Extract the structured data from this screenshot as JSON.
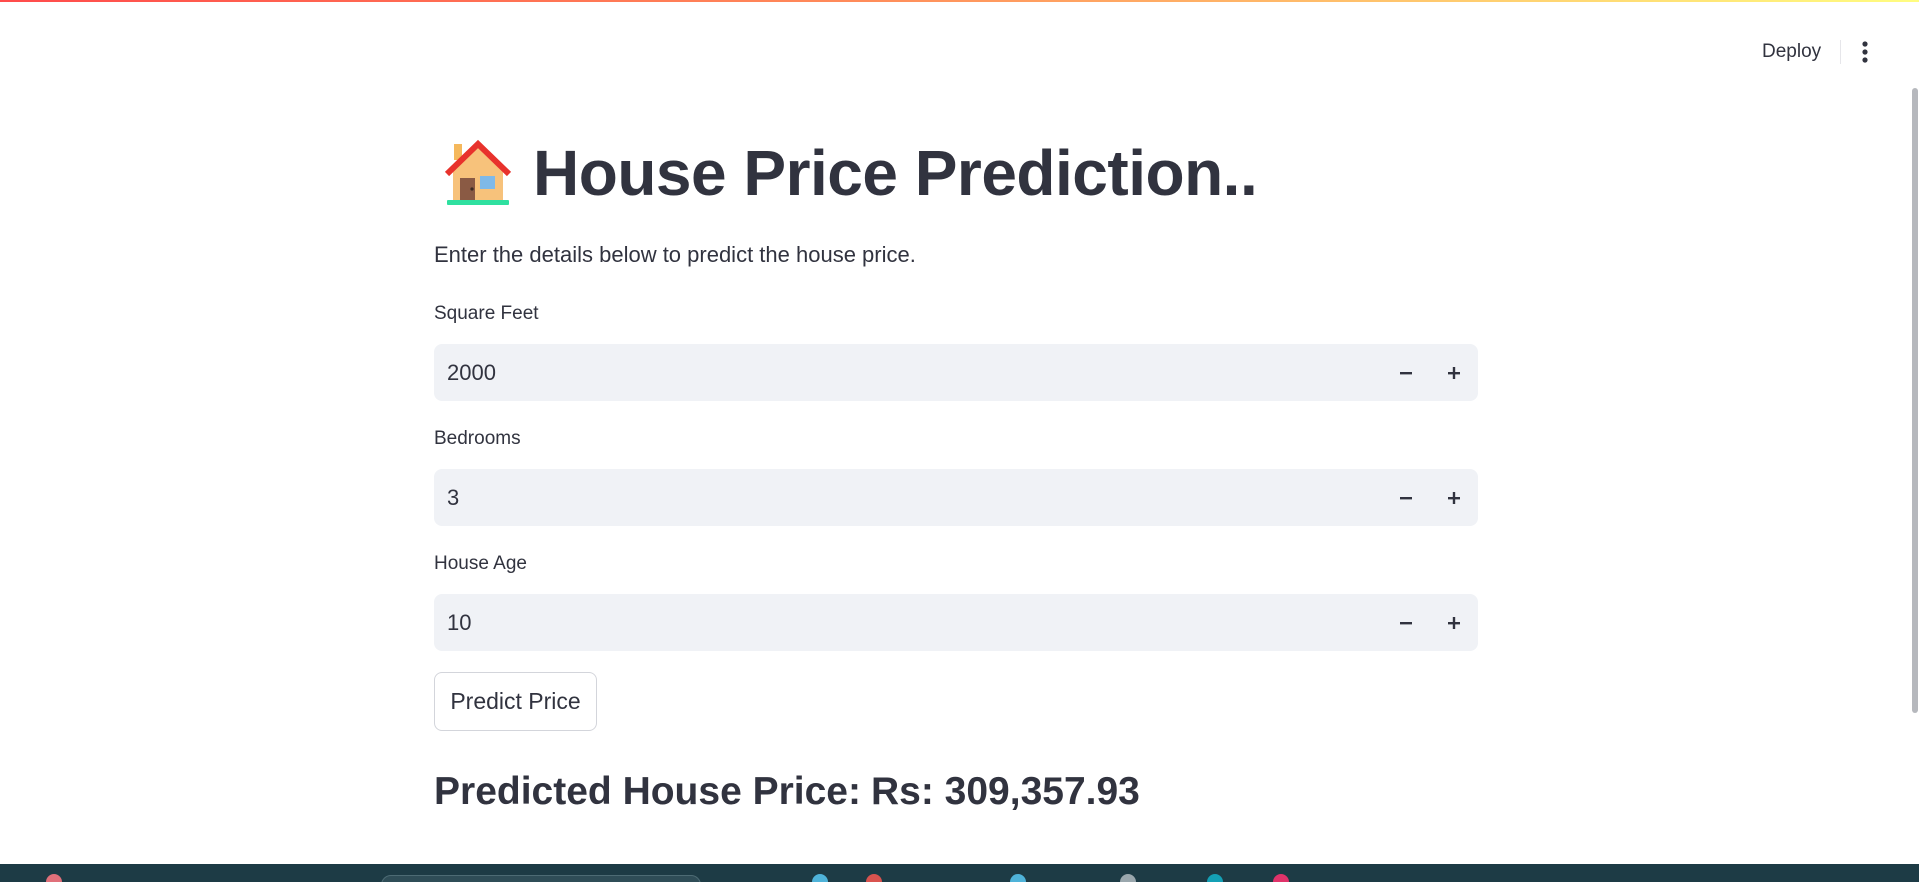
{
  "header": {
    "deploy_label": "Deploy",
    "menu_icon": "more-vertical-icon"
  },
  "main": {
    "title": "House Price Prediction..",
    "title_icon": "house-emoji-icon",
    "subtitle": "Enter the details below to predict the house price."
  },
  "fields": [
    {
      "label": "Square Feet",
      "value": "2000"
    },
    {
      "label": "Bedrooms",
      "value": "3"
    },
    {
      "label": "House Age",
      "value": "10"
    }
  ],
  "predict_button": {
    "label": "Predict Price"
  },
  "result": {
    "label": "Predicted House Price:",
    "value": "Rs: 309,357.93"
  },
  "colors": {
    "text": "#31333f",
    "input_bg": "#f0f2f6",
    "accent": "#ff4b4b",
    "taskbar": "#1d3b45"
  }
}
